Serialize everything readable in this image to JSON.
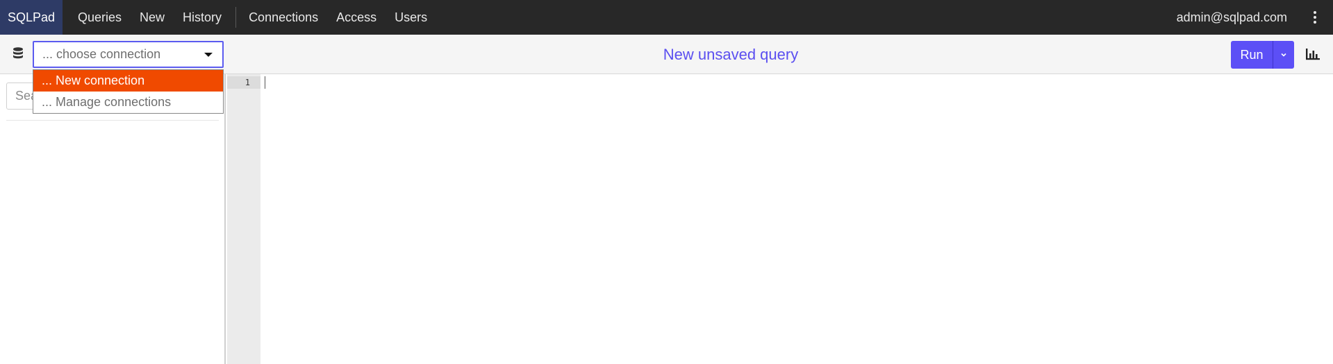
{
  "topnav": {
    "brand": "SQLPad",
    "items": [
      {
        "label": "Queries"
      },
      {
        "label": "New"
      },
      {
        "label": "History"
      }
    ],
    "items_right_group": [
      {
        "label": "Connections"
      },
      {
        "label": "Access"
      },
      {
        "label": "Users"
      }
    ],
    "user_email": "admin@sqlpad.com",
    "menu_icon": "kebab-vertical-icon"
  },
  "toolbar": {
    "connection_select": {
      "placeholder_value": "... choose connection",
      "open": true,
      "options": [
        {
          "label": "... New connection",
          "highlighted": true
        },
        {
          "label": "... Manage connections",
          "highlighted": false
        }
      ]
    },
    "query_title": "New unsaved query",
    "run_label": "Run",
    "icons": {
      "database": "database-icon",
      "run_menu": "chevron-down-icon",
      "chart": "bar-chart-icon"
    }
  },
  "sidebar": {
    "search_placeholder": "Search schema"
  },
  "editor": {
    "line_numbers": [
      "1"
    ],
    "content": ""
  },
  "colors": {
    "nav_background": "#282828",
    "brand_background": "#2e3b66",
    "accent": "#5c4ff6",
    "highlight": "#f04a00"
  }
}
